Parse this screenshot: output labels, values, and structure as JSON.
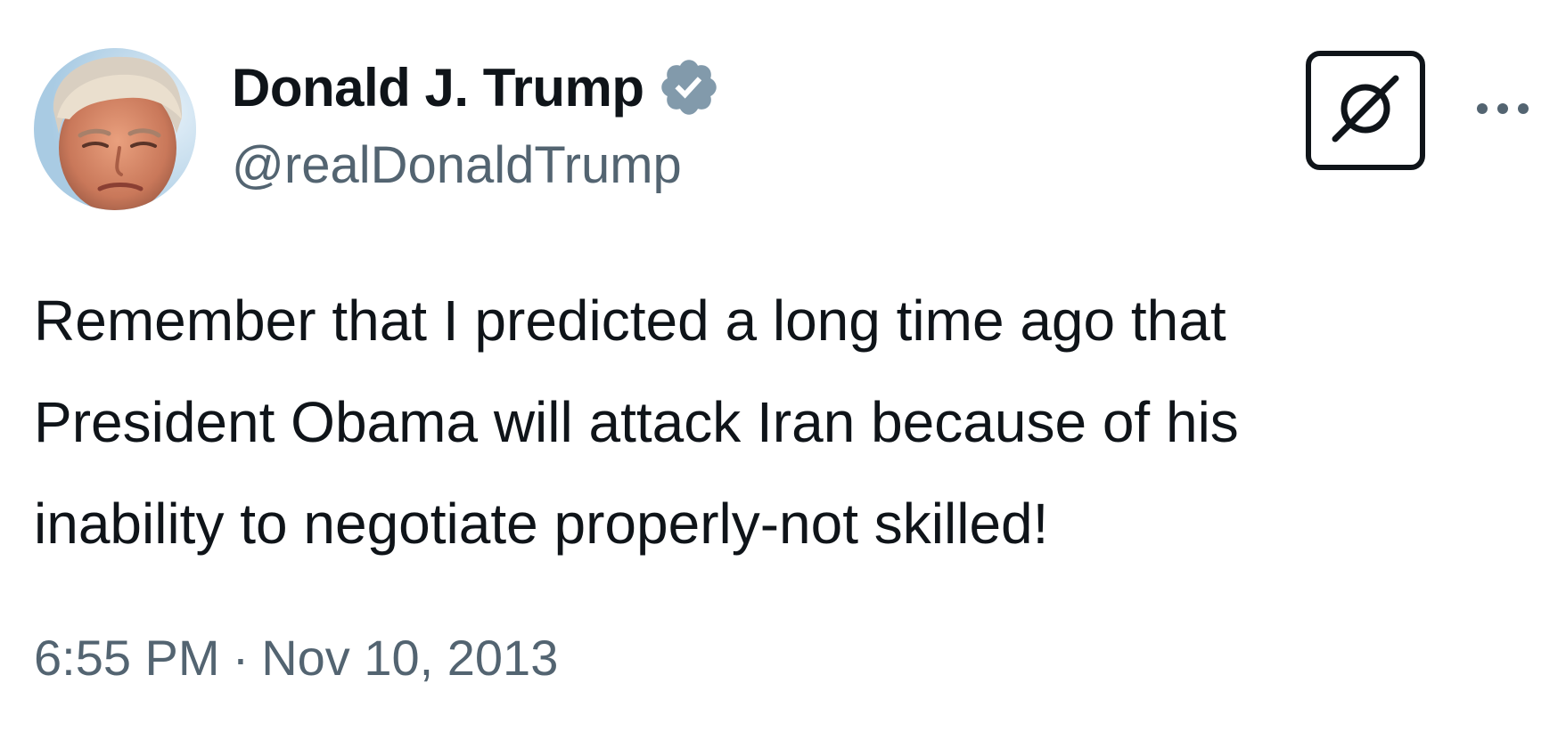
{
  "user": {
    "display_name": "Donald J. Trump",
    "handle": "@realDonaldTrump",
    "verified": true,
    "avatar_icon": "profile-photo",
    "verified_color": "#829aab"
  },
  "actions": {
    "grok_icon": "grok-icon",
    "more_icon": "more-dots-icon"
  },
  "tweet": {
    "lines": [
      "Remember that I predicted a long time ago that",
      "President Obama will attack Iran because of his",
      "inability to negotiate properly-not skilled!"
    ]
  },
  "meta": {
    "time": "6:55 PM",
    "separator": "·",
    "date": "Nov 10, 2013"
  },
  "colors": {
    "text": "#0f1419",
    "secondary": "#536471",
    "background": "#ffffff"
  }
}
